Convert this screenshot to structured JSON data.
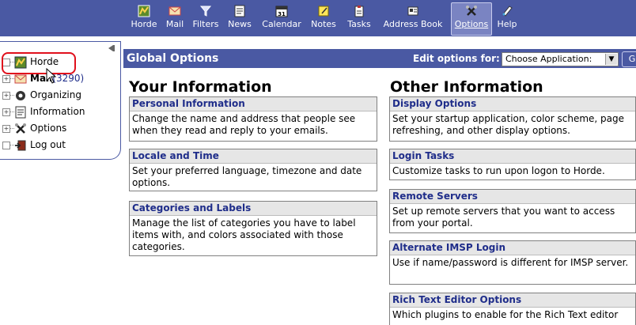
{
  "nav": {
    "items": [
      {
        "label": "Horde",
        "icon": "horde-icon"
      },
      {
        "label": "Mail",
        "icon": "mail-icon"
      },
      {
        "label": "Filters",
        "icon": "filter-icon"
      },
      {
        "label": "News",
        "icon": "news-icon"
      },
      {
        "label": "Calendar",
        "icon": "calendar-icon"
      },
      {
        "label": "Notes",
        "icon": "notes-icon"
      },
      {
        "label": "Tasks",
        "icon": "tasks-icon"
      },
      {
        "label": "Address Book",
        "icon": "address-book-icon"
      },
      {
        "label": "Options",
        "icon": "options-icon",
        "active": true
      },
      {
        "label": "Help",
        "icon": "help-icon"
      }
    ],
    "calendar_day": "31"
  },
  "sidebar": {
    "items": [
      {
        "label": "Horde",
        "icon": "horde-icon",
        "expander": ""
      },
      {
        "label": "Mail",
        "count": "(3290)",
        "icon": "mail-icon",
        "expander": "+"
      },
      {
        "label": "Organizing",
        "icon": "organizing-icon",
        "expander": "+"
      },
      {
        "label": "Information",
        "icon": "information-icon",
        "expander": "+"
      },
      {
        "label": "Options",
        "icon": "options-icon",
        "expander": "+"
      },
      {
        "label": "Log out",
        "icon": "logout-icon",
        "expander": ""
      }
    ]
  },
  "header": {
    "title": "Global Options",
    "edit_label": "Edit options for:",
    "select_value": "Choose Application:",
    "go_label": "G"
  },
  "your_information": {
    "heading": "Your Information",
    "cards": [
      {
        "title": "Personal Information",
        "desc": "Change the name and address that people see when they read and reply to your emails."
      },
      {
        "title": "Locale and Time",
        "desc": "Set your preferred language, timezone and date options."
      },
      {
        "title": "Categories and Labels",
        "desc": "Manage the list of categories you have to label items with, and colors associated with those categories."
      }
    ]
  },
  "other_information": {
    "heading": "Other Information",
    "cards": [
      {
        "title": "Display Options",
        "desc": "Set your startup application, color scheme, page refreshing, and other display options."
      },
      {
        "title": "Login Tasks",
        "desc": "Customize tasks to run upon logon to Horde."
      },
      {
        "title": "Remote Servers",
        "desc": "Set up remote servers that you want to access from your portal."
      },
      {
        "title": "Alternate IMSP Login",
        "desc": "Use if name/password is different for IMSP server."
      },
      {
        "title": "Rich Text Editor Options",
        "desc": "Which plugins to enable for the Rich Text editor"
      }
    ]
  },
  "colors": {
    "accent": "#4a59a3",
    "link": "#1f2d8a",
    "highlight": "#e0101c"
  }
}
